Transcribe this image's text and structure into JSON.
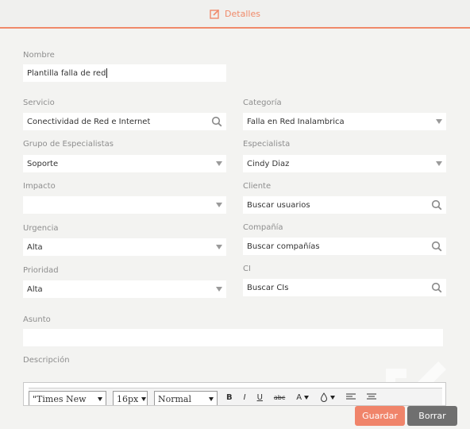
{
  "header": {
    "title": "Detalles"
  },
  "form": {
    "nombre": {
      "label": "Nombre",
      "value": "Plantilla falla de red"
    },
    "servicio": {
      "label": "Servicio",
      "value": "Conectividad de Red e Internet"
    },
    "categoria": {
      "label": "Categoría",
      "value": "Falla en Red Inalambrica"
    },
    "grupo": {
      "label": "Grupo de Especialistas",
      "value": "Soporte"
    },
    "especialista": {
      "label": "Especialista",
      "value": "Cindy Diaz"
    },
    "impacto": {
      "label": "Impacto",
      "value": ""
    },
    "cliente": {
      "label": "Cliente",
      "value": "Buscar usuarios"
    },
    "urgencia": {
      "label": "Urgencia",
      "value": "Alta"
    },
    "compania": {
      "label": "Compañía",
      "value": "Buscar compañías"
    },
    "prioridad": {
      "label": "Prioridad",
      "value": "Alta"
    },
    "ci": {
      "label": "CI",
      "value": "Buscar CIs"
    },
    "asunto": {
      "label": "Asunto",
      "value": ""
    },
    "descripcion": {
      "label": "Descripción"
    }
  },
  "editor": {
    "font_family": "\"Times New",
    "font_size": "16px",
    "format": "Normal",
    "bold": "B",
    "italic": "I",
    "underline": "U",
    "strike": "abc",
    "font_color": "A"
  },
  "actions": {
    "save": "Guardar",
    "delete": "Borrar"
  },
  "colors": {
    "accent": "#f0846a",
    "dark_button": "#6f6f6f"
  }
}
